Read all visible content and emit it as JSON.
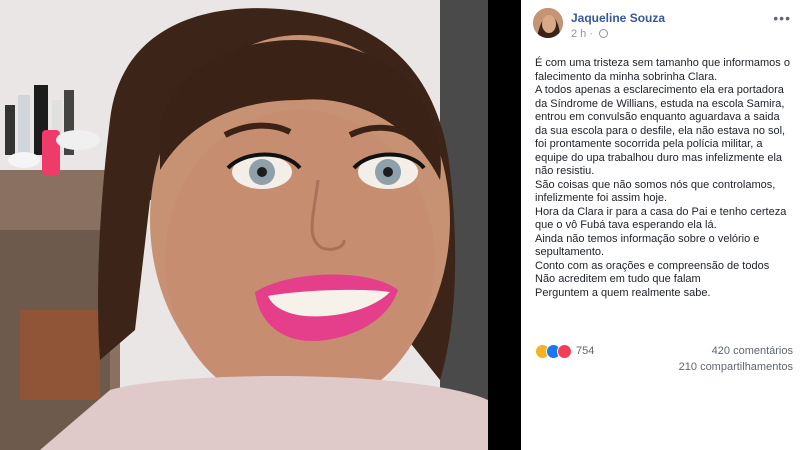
{
  "post": {
    "author": "Jaqueline Souza",
    "time": "2 h",
    "more_label": "•••",
    "paragraphs": [
      "É com uma tristeza sem tamanho que informamos o falecimento da minha sobrinha Clara.",
      "A todos apenas a esclarecimento ela era portadora da Síndrome de Willians, estuda na escola Samira, entrou em convulsão enquanto aguardava a saida da sua escola para o desfile, ela não estava no sol, foi prontamente socorrida pela polícia militar, a equipe do upa trabalhou duro mas infelizmente ela não resistiu.",
      "São coisas que não somos nós que controlamos, infelizmente foi assim hoje.",
      "Hora da Clara ir para a casa do Pai e tenho certeza que o vô Fubá tava esperando ela lá.",
      "Ainda não temos informação sobre o velório e sepultamento.",
      "Conto com as orações e compreensão de todos",
      "Não acreditem em tudo que falam",
      "Perguntem a quem realmente sabe."
    ],
    "reactions_count": "754",
    "comments": "420 comentários",
    "shares": "210 compartilhamentos"
  },
  "icons": {
    "reactions": [
      "sad-reaction-icon",
      "like-reaction-icon",
      "love-reaction-icon"
    ],
    "privacy": "globe-icon"
  },
  "colors": {
    "author_link": "#385898",
    "meta": "#90949c",
    "like": "#1877f2",
    "love": "#f33e58",
    "sad": "#f7b125"
  }
}
